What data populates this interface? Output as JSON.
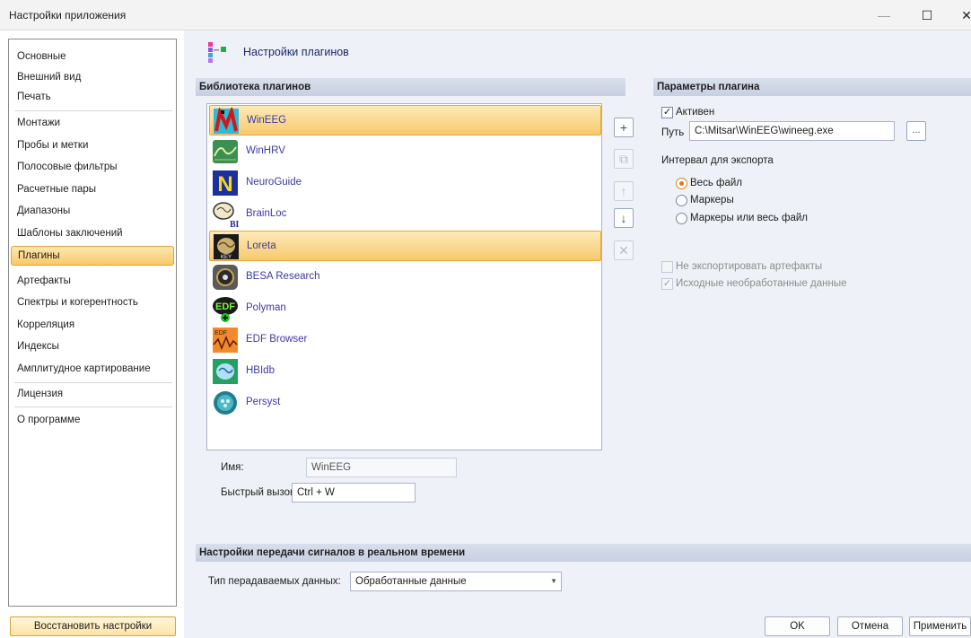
{
  "window": {
    "title": "Настройки приложения",
    "minimize_glyph": "—",
    "maximize_glyph": "☐",
    "close_glyph": "✕"
  },
  "nav": {
    "items": [
      {
        "label": "Основные"
      },
      {
        "label": "Внешний вид"
      },
      {
        "label": "Печать"
      },
      {
        "label": "Монтажи"
      },
      {
        "label": "Пробы и метки"
      },
      {
        "label": "Полосовые фильтры"
      },
      {
        "label": "Расчетные пары"
      },
      {
        "label": "Диапазоны"
      },
      {
        "label": "Шаблоны заключений"
      },
      {
        "label": "Плагины",
        "selected": true
      },
      {
        "label": "Артефакты"
      },
      {
        "label": "Спектры и когерентность"
      },
      {
        "label": "Корреляция"
      },
      {
        "label": "Индексы"
      },
      {
        "label": "Амплитудное картирование"
      },
      {
        "label": "Лицензия"
      },
      {
        "label": "О программе"
      }
    ],
    "restore_button": "Восстановить настройки"
  },
  "page": {
    "title": "Настройки плагинов",
    "icon": "plugins-icon"
  },
  "library": {
    "heading": "Библиотека плагинов",
    "plugins": [
      {
        "name": "WinEEG",
        "icon": "wineeg-icon",
        "selected": true
      },
      {
        "name": "WinHRV",
        "icon": "winhrv-icon"
      },
      {
        "name": "NeuroGuide",
        "icon": "neuroguide-icon"
      },
      {
        "name": "BrainLoc",
        "icon": "brainloc-icon"
      },
      {
        "name": "Loreta",
        "icon": "loreta-icon",
        "highlighted": true
      },
      {
        "name": "BESA Research",
        "icon": "besa-icon"
      },
      {
        "name": "Polyman",
        "icon": "polyman-icon"
      },
      {
        "name": "EDF Browser",
        "icon": "edf-browser-icon"
      },
      {
        "name": "HBIdb",
        "icon": "hbidb-icon"
      },
      {
        "name": "Persyst",
        "icon": "persyst-icon"
      }
    ],
    "side_buttons": {
      "add": "+",
      "copy": "⧉",
      "up": "↑",
      "down": "↓",
      "delete": "✕"
    },
    "name_label": "Имя:",
    "name_value": "WinEEG",
    "hotkey_label": "Быстрый вызов:",
    "hotkey_value": "Ctrl + W"
  },
  "params": {
    "heading": "Параметры плагина",
    "active_label": "Активен",
    "active_checked": true,
    "path_label": "Путь",
    "path_value": "C:\\Mitsar\\WinEEG\\wineeg.exe",
    "browse_label": "...",
    "export_interval_label": "Интервал для экспорта",
    "radios": [
      {
        "label": "Весь файл",
        "checked": true
      },
      {
        "label": "Маркеры",
        "checked": false
      },
      {
        "label": "Маркеры или весь файл",
        "checked": false
      }
    ],
    "no_artifacts_label": "Не экспортировать артефакты",
    "raw_data_label": "Исходные необработанные данные"
  },
  "realtime": {
    "heading": "Настройки передачи сигналов в реальном времени",
    "data_type_label": "Тип перадаваемых данных:",
    "data_type_value": "Обработанные данные"
  },
  "footer": {
    "ok": "OK",
    "cancel": "Отмена",
    "apply": "Применить"
  },
  "colors": {
    "selection": "#f8c866",
    "section_header": "#c7d0e2",
    "panel_background": "#eef1f7",
    "link_text": "#3a3aa8"
  }
}
